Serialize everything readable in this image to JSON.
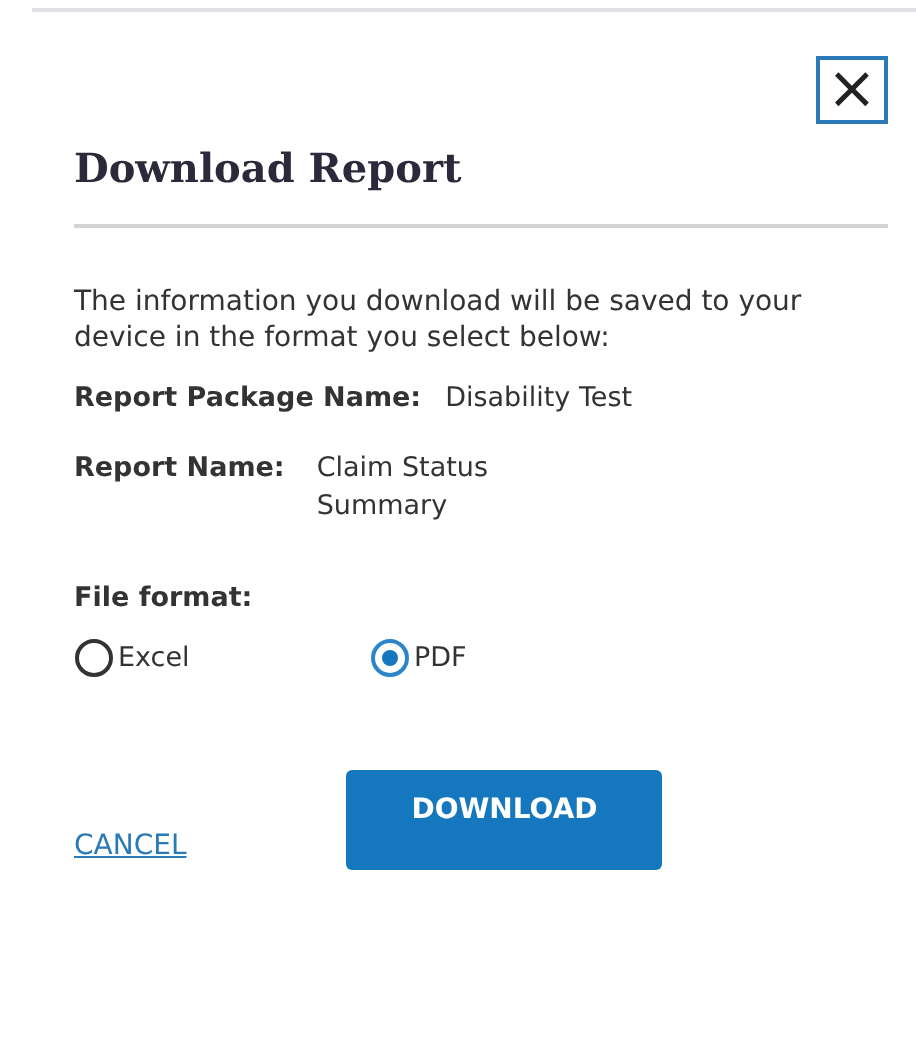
{
  "dialog": {
    "title": "Download Report",
    "close": "×",
    "intro": "The information you download will be saved to your device in the format you select below:",
    "details": [
      {
        "label": "Report Package Name:",
        "value": "Disability Test"
      },
      {
        "label": "Report Name:",
        "value": "Claim Status Summary"
      }
    ],
    "format_label": "File format:",
    "formats": [
      {
        "label": "Excel",
        "selected": false
      },
      {
        "label": "PDF",
        "selected": true
      }
    ],
    "cancel": "CANCEL",
    "download": "DOWNLOAD"
  }
}
